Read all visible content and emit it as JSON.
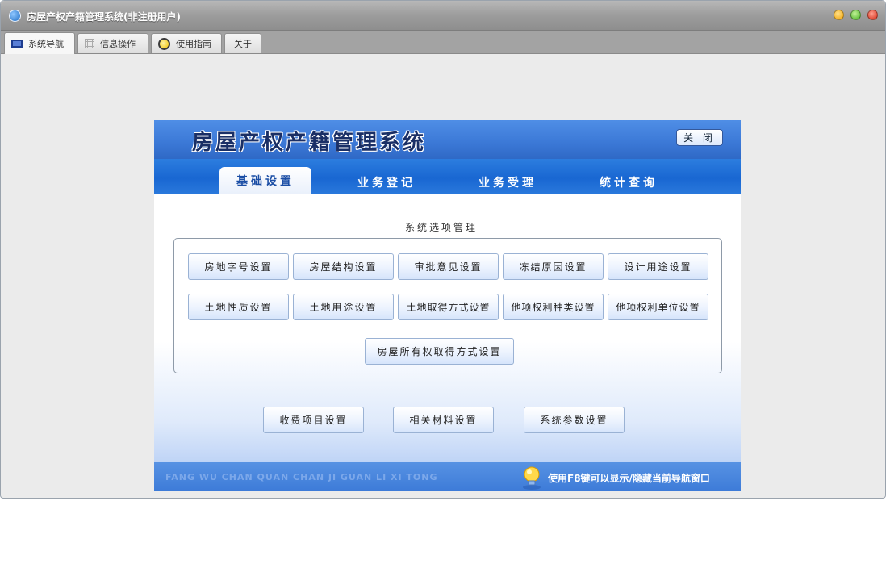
{
  "window": {
    "title": "房屋产权产籍管理系统(非注册用户)"
  },
  "tabs": [
    {
      "label": "系统导航",
      "icon": "monitor-icon",
      "active": true
    },
    {
      "label": "信息操作",
      "icon": "grid-icon",
      "active": false
    },
    {
      "label": "使用指南",
      "icon": "help-circle-icon",
      "active": false
    },
    {
      "label": "关于",
      "icon": "",
      "active": false
    }
  ],
  "panel": {
    "title": "房屋产权产籍管理系统",
    "close_label": "关 闭",
    "nav_tabs": [
      {
        "label": "基础设置",
        "active": true
      },
      {
        "label": "业务登记",
        "active": false
      },
      {
        "label": "业务受理",
        "active": false
      },
      {
        "label": "统计查询",
        "active": false
      }
    ],
    "section_title": "系统选项管理",
    "option_buttons": [
      "房地字号设置",
      "房屋结构设置",
      "审批意见设置",
      "冻结原因设置",
      "设计用途设置",
      "土地性质设置",
      "土地用途设置",
      "土地取得方式设置",
      "他项权利种类设置",
      "他项权利单位设置",
      "房屋所有权取得方式设置"
    ],
    "extra_buttons": [
      "收费项目设置",
      "相关材料设置",
      "系统参数设置"
    ],
    "footer": {
      "pinyin": "FANG WU CHAN QUAN CHAN JI GUAN LI XI TONG",
      "hint": "使用F8键可以显示/隐藏当前导航窗口"
    }
  },
  "colors": {
    "header_blue": "#3b78d6",
    "nav_blue": "#1967d2",
    "title_dark": "#1a2f66"
  }
}
